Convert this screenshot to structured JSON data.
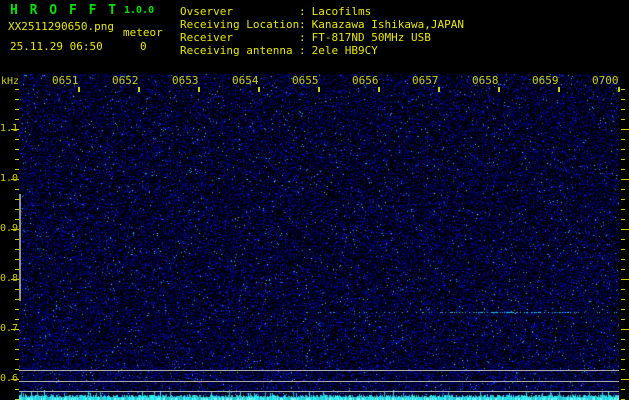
{
  "header": {
    "app_title": "H R O F F T",
    "version": "1.0.0",
    "filename": "XX2511290650.png",
    "counter_label": "meteor",
    "counter_value": "0",
    "datetime": "25.11.29 06:50",
    "separator": ":",
    "info_rows": [
      {
        "label": "Ovserver",
        "value": "Lacofilms"
      },
      {
        "label": "Receiving Location",
        "value": "Kanazawa Ishikawa,JAPAN"
      },
      {
        "label": "Receiver",
        "value": "FT-817ND 50MHz USB"
      },
      {
        "label": "Receiving antenna",
        "value": "2ele HB9CY"
      }
    ]
  },
  "plot": {
    "y_unit_label": "kHz",
    "time_tick_labels": [
      "0651",
      "0652",
      "0653",
      "0654",
      "0655",
      "0656",
      "0657",
      "0658",
      "0659",
      "0700"
    ],
    "freq_tick_labels": [
      "1.1",
      "1.0",
      "0.9",
      "0.8",
      "0.7",
      "0.6"
    ]
  },
  "colors": {
    "background": "#000000",
    "title_green": "#00e400",
    "header_yellow": "#e8e800",
    "axis_yellow": "#d0d000",
    "grid_gray": "#aaaaaa",
    "marker_gray": "#909090",
    "trace_cyan": "#00e8e8",
    "noise_blue": "#0000ff"
  },
  "chart_data": {
    "type": "heatmap",
    "title": "HROFFT 1.0.0 radio meteor observation spectrogram",
    "date": "25.11.29",
    "start_time": "06:50",
    "x_axis": {
      "unit": "time (hhmm, 1-minute divisions, 10-minute window)",
      "tick_labels": [
        "0651",
        "0652",
        "0653",
        "0654",
        "0655",
        "0656",
        "0657",
        "0658",
        "0659",
        "0700"
      ]
    },
    "y_axis": {
      "unit": "kHz",
      "tick_values": [
        1.1,
        1.0,
        0.9,
        0.8,
        0.7,
        0.6
      ],
      "top_khz": 1.19,
      "bottom_khz": 0.56,
      "minor_tick_step_khz": 0.02
    },
    "meteor_echo_count": 0,
    "echoes": [],
    "features": [
      {
        "type": "background-noise",
        "description": "uniform sparse dark-blue noise speckle over black across the full window, slightly denser toward the bottom"
      },
      {
        "type": "faint-carrier-line",
        "frequency_khz": 0.73,
        "description": "very faint dotted horizontal line visible mainly in the right half (about 0655-0700)"
      },
      {
        "type": "level-reference-lines",
        "description": "three horizontal gray lines near the bottom of the plot at about 0.62, 0.60 and 0.58 kHz"
      },
      {
        "type": "left-edge-marker",
        "description": "vertical gray bar at the left plot edge spanning roughly 0.97 to 0.76 kHz"
      },
      {
        "type": "noise-level-trace",
        "description": "cyan signal-strength waveform strip along the very bottom of the plot"
      }
    ]
  }
}
